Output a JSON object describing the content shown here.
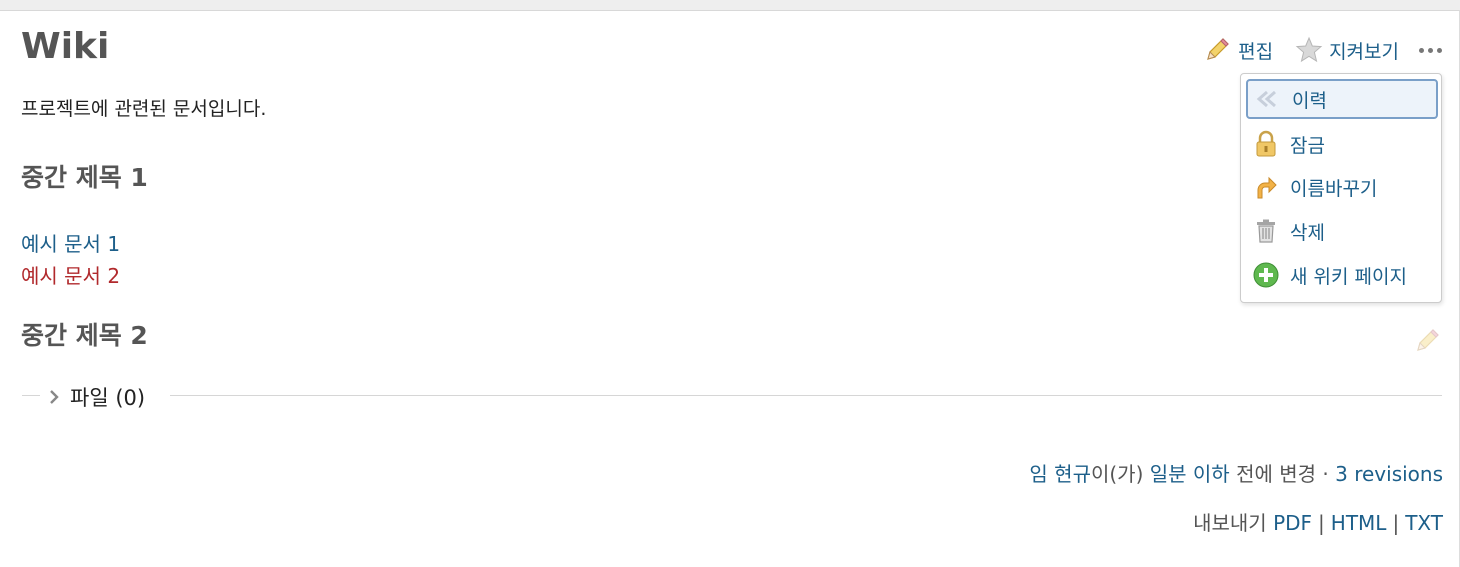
{
  "page": {
    "title": "Wiki",
    "description": "프로젝트에 관련된 문서입니다.",
    "heading1": "중간 제목 1",
    "links": [
      "예시 문서 1",
      "예시 문서 2"
    ],
    "heading2": "중간 제목 2"
  },
  "contextual": {
    "edit_label": "편집",
    "watch_label": "지켜보기"
  },
  "dropdown": {
    "items": [
      {
        "label": "이력",
        "icon": "history-icon"
      },
      {
        "label": "잠금",
        "icon": "lock-icon"
      },
      {
        "label": "이름바꾸기",
        "icon": "rename-icon"
      },
      {
        "label": "삭제",
        "icon": "trash-icon"
      },
      {
        "label": "새 위키 페이지",
        "icon": "add-icon"
      }
    ]
  },
  "files": {
    "label": "파일 (0)"
  },
  "footer": {
    "author": "임 현규",
    "author_suffix": "이(가)",
    "time": "일분 이하",
    "changed_text": "전에 변경 ·",
    "revisions": "3 revisions",
    "export_label": "내보내기",
    "formats": [
      "PDF",
      "HTML",
      "TXT"
    ]
  },
  "colors": {
    "link": "#1d5f8a",
    "link_missing": "#b1292c",
    "heading": "#555555"
  }
}
